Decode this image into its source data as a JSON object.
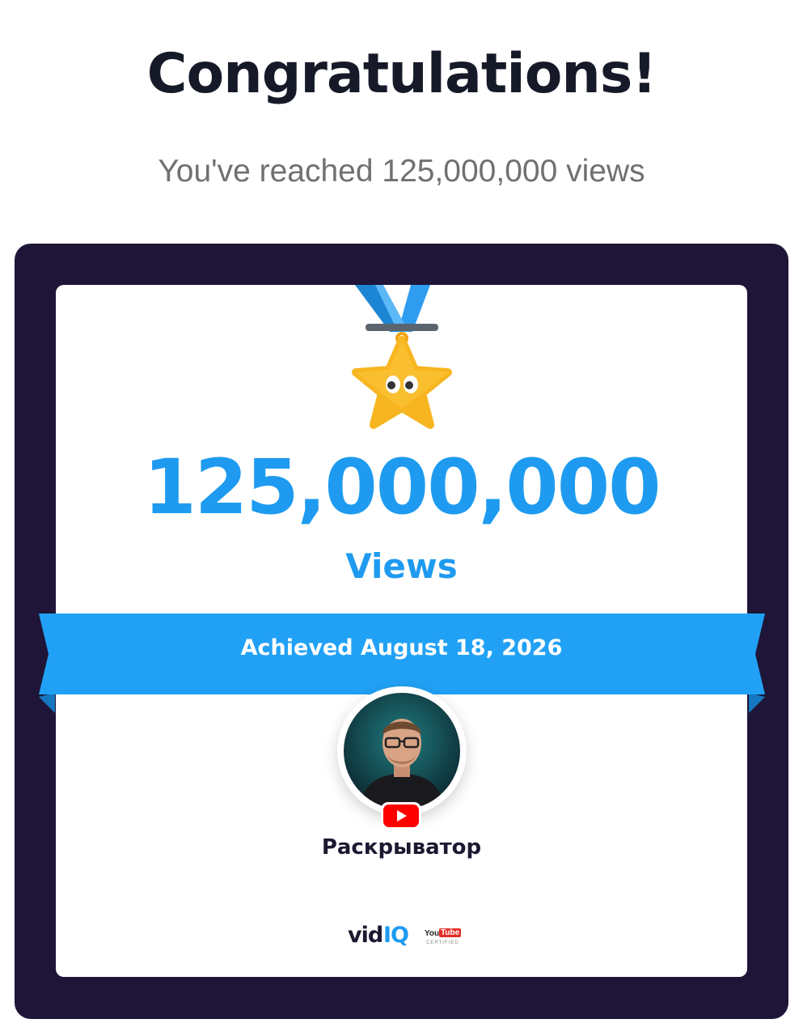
{
  "header": {
    "title": "Congratulations!",
    "subtitle": "You've reached 125,000,000 views"
  },
  "card": {
    "milestone_value": "125,000,000",
    "milestone_unit": "Views",
    "achieved_text": "Achieved August 18, 2026",
    "channel_name": "Раскрыватор",
    "medal_icon": "star-medal-icon",
    "avatar_icon": "channel-avatar",
    "platform_icon": "youtube-icon"
  },
  "branding": {
    "vid": "vid",
    "iq": "IQ",
    "yt_you": "You",
    "yt_tube": "Tube",
    "yt_certified": "CERTIFIED"
  },
  "colors": {
    "accent": "#1e9bf0",
    "frame": "#1e1538",
    "title": "#161a28",
    "subtitle": "#707070",
    "star": "#f7b520",
    "youtube_red": "#ff0000"
  }
}
